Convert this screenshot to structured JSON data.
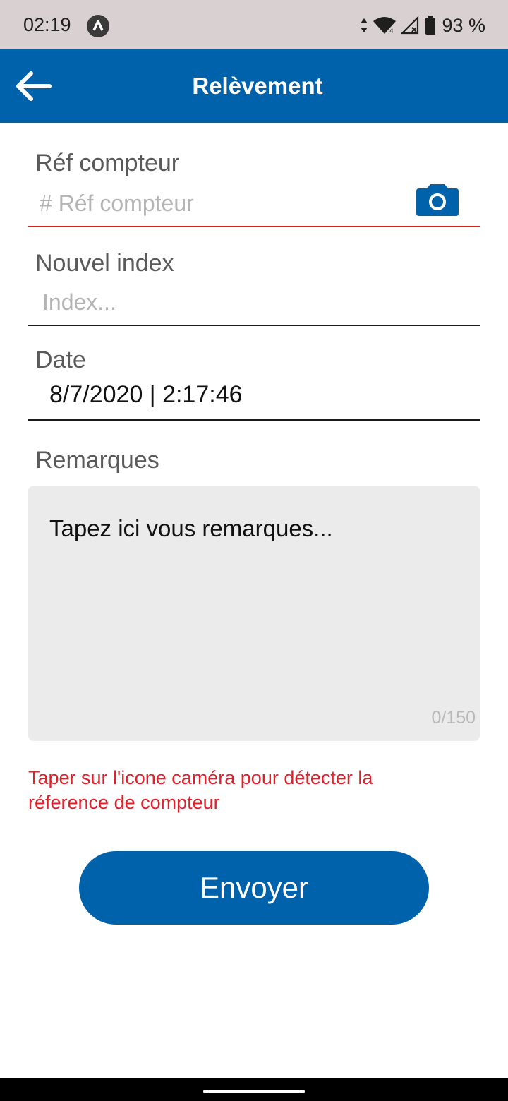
{
  "status_bar": {
    "time": "02:19",
    "battery": "93 %",
    "icons": [
      "app-notification-icon",
      "data-arrows-icon",
      "wifi-icon",
      "cell-signal-icon",
      "battery-icon"
    ]
  },
  "app_bar": {
    "title": "Relèvement",
    "back_icon": "arrow-left-icon",
    "background_color": "#0062aa"
  },
  "form": {
    "ref": {
      "label": "Réf compteur",
      "placeholder": "# Réf compteur",
      "value": "",
      "camera_icon": "camera-icon"
    },
    "index": {
      "label": "Nouvel index",
      "placeholder": "Index...",
      "value": ""
    },
    "date": {
      "label": "Date",
      "value": "8/7/2020 | 2:17:46"
    },
    "remarks": {
      "label": "Remarques",
      "text": "Tapez ici vous remarques...",
      "counter": "0/150"
    },
    "hint": " Taper sur l'icone caméra pour détecter la réference de compteur",
    "submit_label": "Envoyer"
  },
  "colors": {
    "primary": "#0062aa",
    "error": "#e0202a",
    "status_bar": "#d9d1d1"
  }
}
